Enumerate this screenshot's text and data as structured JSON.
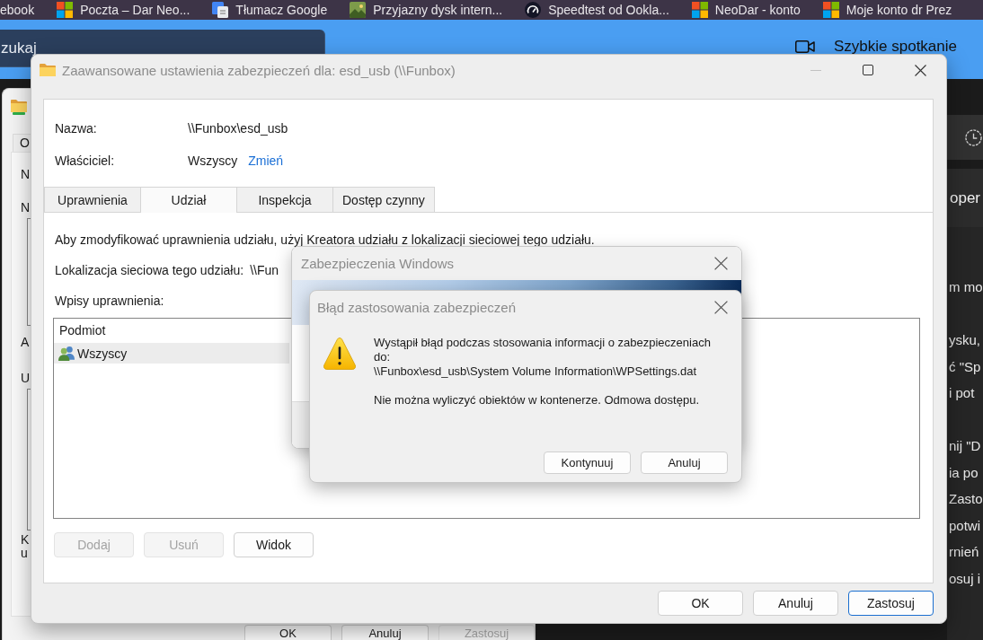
{
  "browser": {
    "bookmarks": [
      {
        "kind": "text",
        "label": "ebook"
      },
      {
        "kind": "squares",
        "label": "Poczta – Dar Neo..."
      },
      {
        "kind": "document",
        "label": "Tłumacz Google"
      },
      {
        "kind": "picture",
        "label": "Przyjazny dysk intern..."
      },
      {
        "kind": "gauge",
        "label": "Speedtest od Ookla..."
      },
      {
        "kind": "squares",
        "label": "NeoDar - konto"
      },
      {
        "kind": "squares",
        "label": "Moje konto dr Prez"
      }
    ],
    "search": {
      "placeholder": "zukaj"
    },
    "meeting_button": {
      "label": "Szybkie spotkanie"
    }
  },
  "side_panel": {
    "heading": "oper",
    "paragraphs": [
      "m mo",
      "ysku,\nć \"Sp\ni pot",
      "nij \"D\nia po\nZasto\npotwi\nrnień\nosuj i"
    ]
  },
  "background_window": {
    "tab": "O",
    "labels": [
      "N",
      "N",
      "A",
      "U",
      "K",
      "u"
    ],
    "buttons": [
      {
        "label": "OK",
        "disabled": false
      },
      {
        "label": "Anuluj",
        "disabled": false
      },
      {
        "label": "Zastosuj",
        "disabled": true
      }
    ]
  },
  "dialog": {
    "title": "Zaawansowane ustawienia zabezpieczeń dla: esd_usb (\\\\Funbox)",
    "minimize": {
      "disabled": true
    },
    "name_label": "Nazwa:",
    "name_value": "\\\\Funbox\\esd_usb",
    "owner_label": "Właściciel:",
    "owner_value": "Wszyscy",
    "owner_link": "Zmień",
    "tabs": [
      {
        "label": "Uprawnienia",
        "selected": false
      },
      {
        "label": "Udział",
        "selected": true
      },
      {
        "label": "Inspekcja",
        "selected": false
      },
      {
        "label": "Dostęp czynny",
        "selected": false
      }
    ],
    "info": "Aby zmodyfikować uprawnienia udziału, użyj Kreatora udziału z lokalizacji sieciowej tego udziału.",
    "location_label": "Lokalizacja sieciowa tego udziału:",
    "location_value": "\\\\Fun",
    "entries_label": "Wpisy uprawnienia:",
    "entries": {
      "columns": [
        "Podmiot"
      ],
      "rows": [
        {
          "principal": "Wszyscy",
          "selected": true
        }
      ]
    },
    "entry_buttons": [
      {
        "label": "Dodaj",
        "disabled": true
      },
      {
        "label": "Usuń",
        "disabled": true
      },
      {
        "label": "Widok",
        "disabled": false
      }
    ],
    "buttons": [
      {
        "label": "OK",
        "default": false
      },
      {
        "label": "Anuluj",
        "default": false
      },
      {
        "label": "Zastosuj",
        "default": true
      }
    ]
  },
  "security_dialog": {
    "title": "Zabezpieczenia Windows"
  },
  "error_dialog": {
    "title": "Błąd zastosowania zabezpieczeń",
    "message": "Wystąpił błąd podczas stosowania informacji o zabezpieczeniach\ndo:\n\\\\Funbox\\esd_usb\\System Volume Information\\WPSettings.dat",
    "detail": "Nie można wyliczyć obiektów w kontenerze. Odmowa dostępu.",
    "buttons": [
      {
        "label": "Kontynuuj"
      },
      {
        "label": "Anuluj"
      }
    ]
  }
}
